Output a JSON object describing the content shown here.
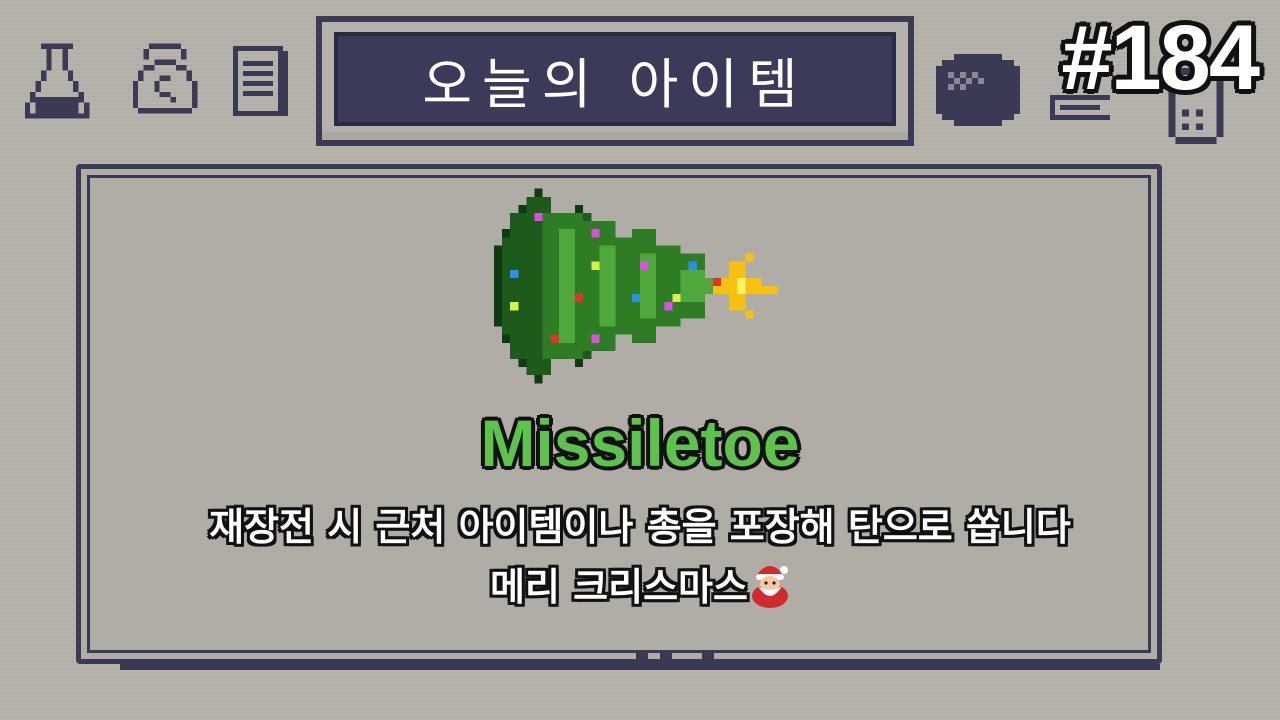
{
  "header": {
    "title": "오늘의 아이템",
    "episode": "#184"
  },
  "top_icons": [
    "flask-icon",
    "money-bag-icon",
    "notes-icon"
  ],
  "right_icons": [
    "ball-icon",
    "device-icon"
  ],
  "item": {
    "name": "Missiletoe",
    "sprite_icon": "christmas-tree-icon",
    "description_line1": "재장전 시 근처 아이템이나 총을 포장해 탄으로 쏩니다",
    "description_line2": "메리 크리스마스",
    "description_emoji": "santa-icon"
  },
  "colors": {
    "background": "#b5b1ab",
    "frame": "#3b3a55",
    "title_bg": "#3b3a58",
    "item_name": "#5cc44a",
    "text": "#ffffff",
    "outline": "#111111"
  }
}
